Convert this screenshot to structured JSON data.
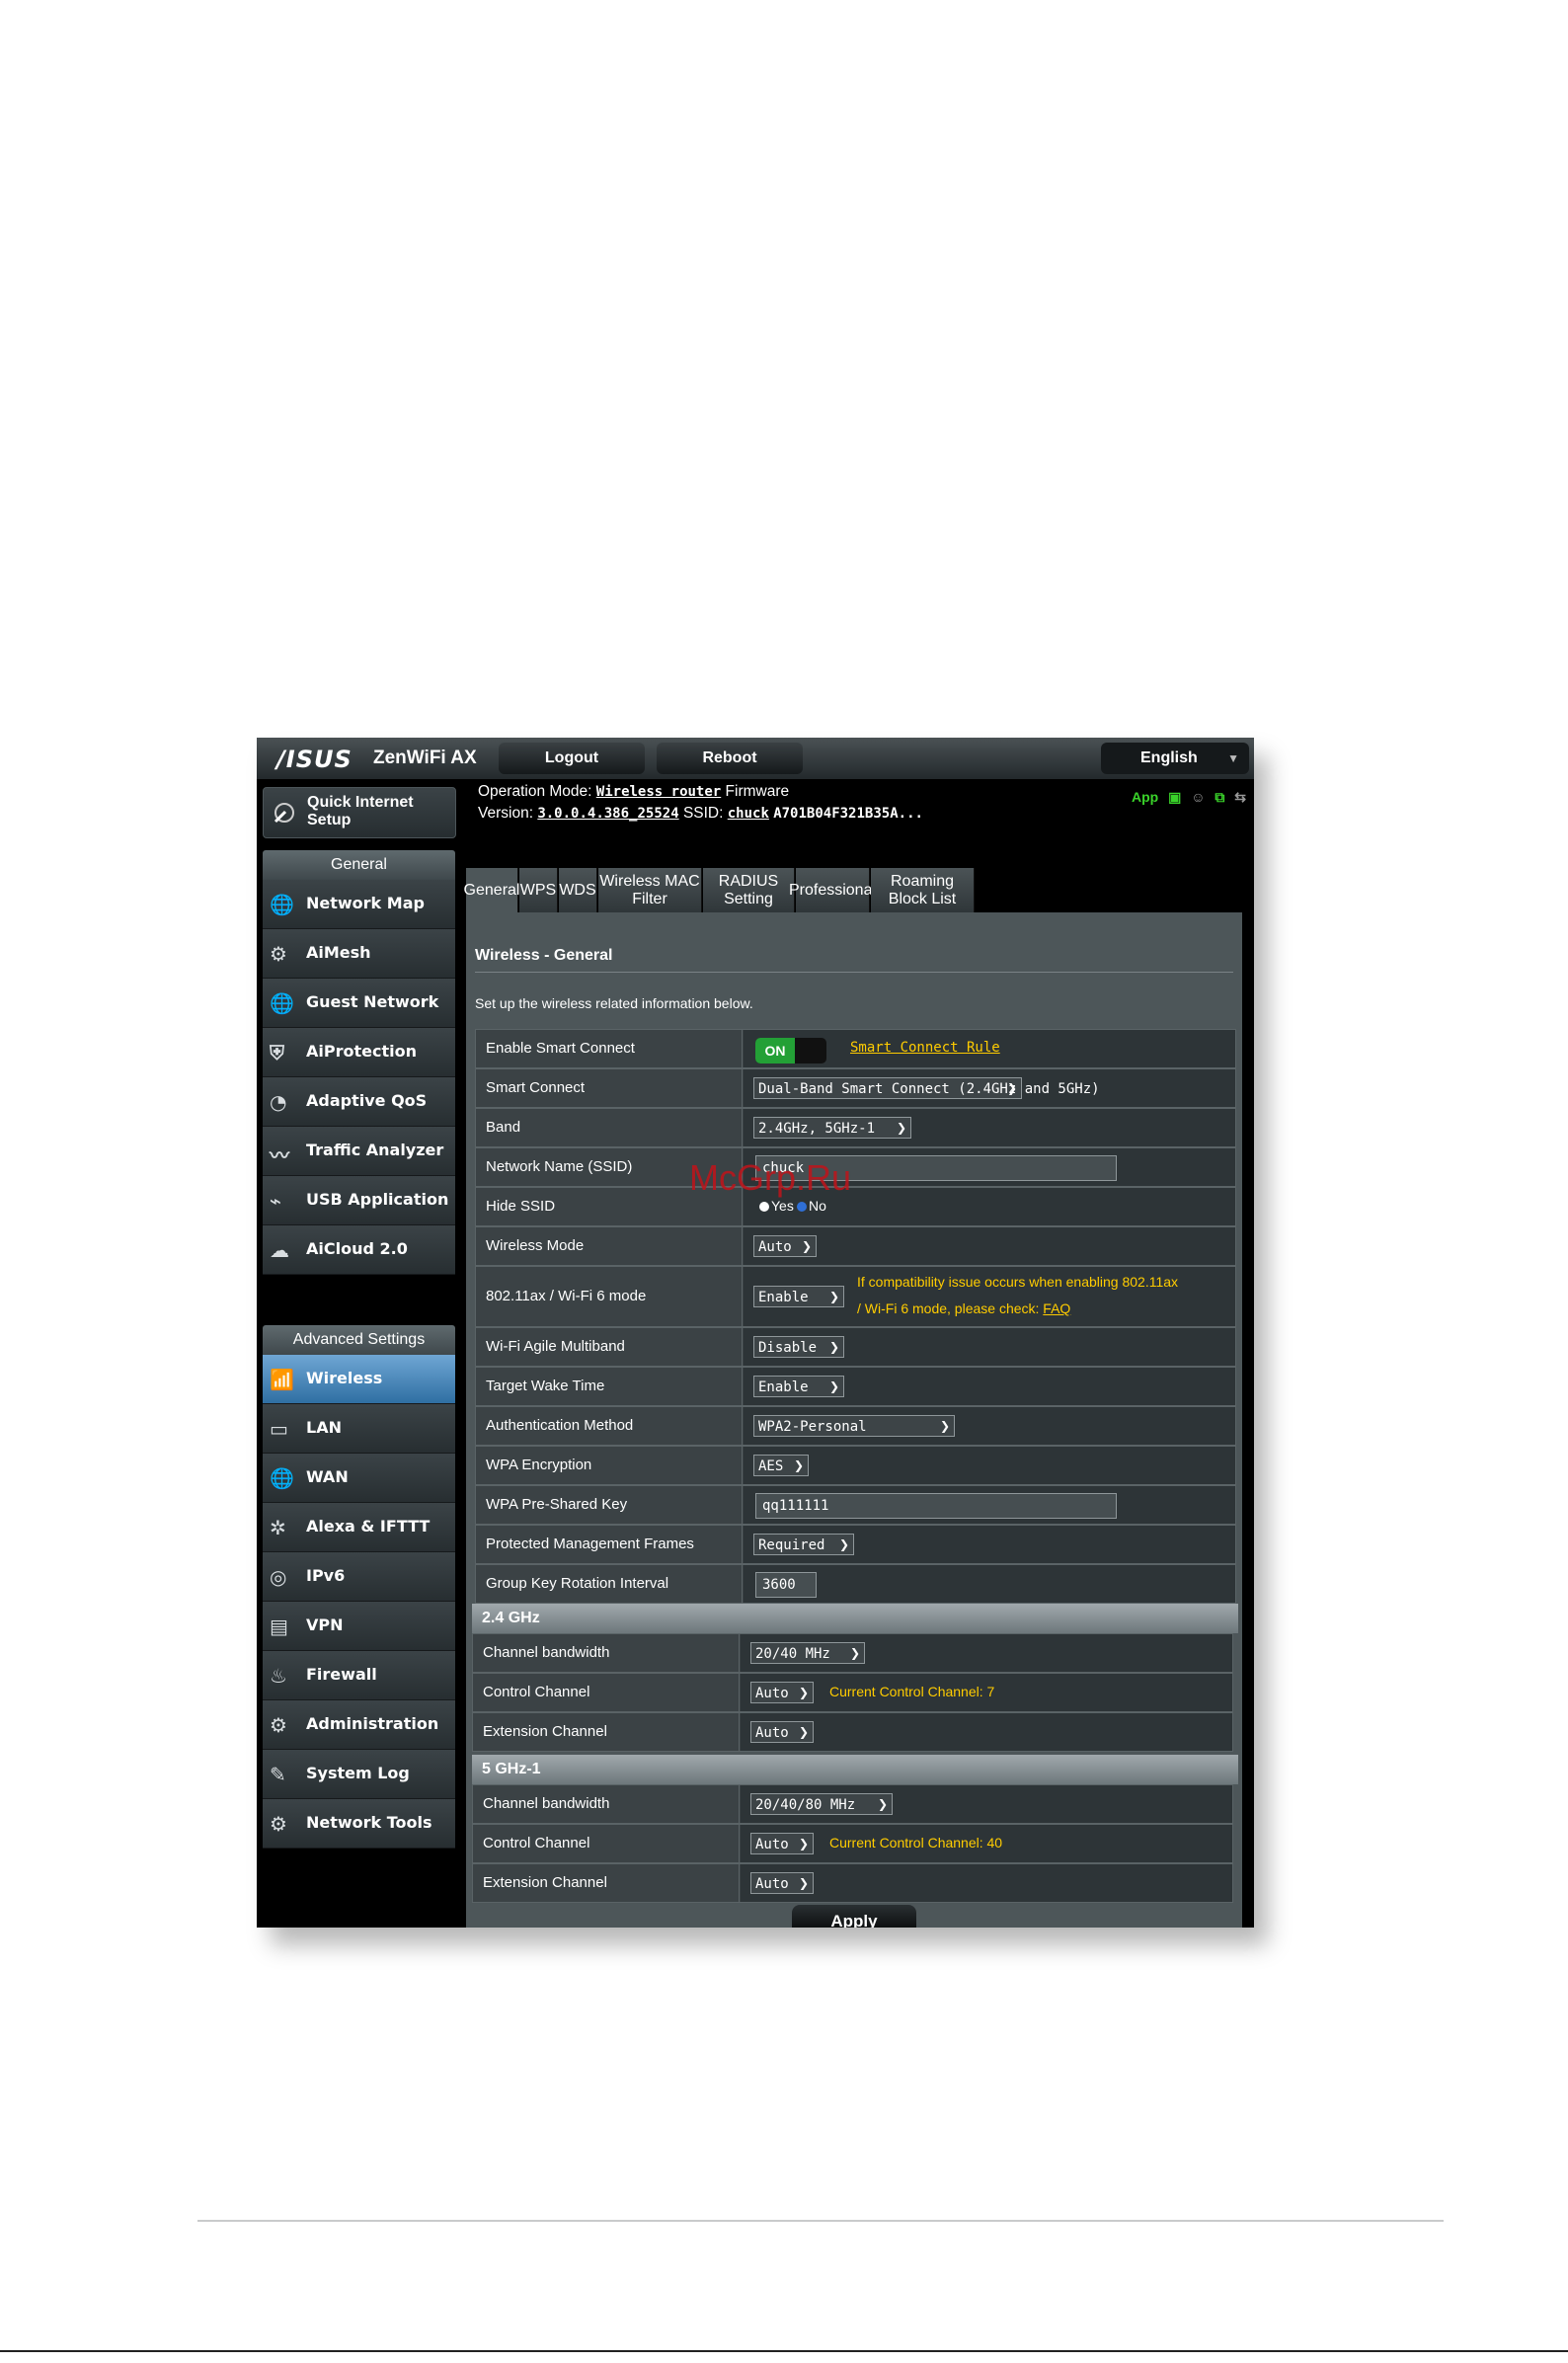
{
  "header": {
    "brand": "/ISUS",
    "model": "ZenWiFi AX",
    "logout_label": "Logout",
    "reboot_label": "Reboot",
    "language": "English"
  },
  "info": {
    "opmode_label": "Operation Mode:",
    "opmode_value": "Wireless router",
    "firmware_label": "Firmware",
    "version_label": "Version:",
    "version_value": "3.0.0.4.386_25524",
    "ssid_label": "SSID:",
    "ssid_value": "chuck",
    "ssid_extra": "A701B04F321B35A...",
    "app_label": "App"
  },
  "sidebar": {
    "qis_label": "Quick Internet Setup",
    "general_header": "General",
    "general_items": [
      {
        "label": "Network Map",
        "icon": "globe-icon"
      },
      {
        "label": "AiMesh",
        "icon": "mesh-icon"
      },
      {
        "label": "Guest Network",
        "icon": "guest-globe-icon"
      },
      {
        "label": "AiProtection",
        "icon": "shield-icon"
      },
      {
        "label": "Adaptive QoS",
        "icon": "gauge-icon"
      },
      {
        "label": "Traffic Analyzer",
        "icon": "pulse-icon"
      },
      {
        "label": "USB Application",
        "icon": "usb-icon"
      },
      {
        "label": "AiCloud 2.0",
        "icon": "cloud-icon"
      }
    ],
    "advanced_header": "Advanced Settings",
    "advanced_items": [
      {
        "label": "Wireless",
        "icon": "wifi-icon"
      },
      {
        "label": "LAN",
        "icon": "lan-icon"
      },
      {
        "label": "WAN",
        "icon": "wan-globe-icon"
      },
      {
        "label": "Alexa & IFTTT",
        "icon": "alexa-icon"
      },
      {
        "label": "IPv6",
        "icon": "ipv6-icon"
      },
      {
        "label": "VPN",
        "icon": "vpn-icon"
      },
      {
        "label": "Firewall",
        "icon": "fire-icon"
      },
      {
        "label": "Administration",
        "icon": "admin-icon"
      },
      {
        "label": "System Log",
        "icon": "log-icon"
      },
      {
        "label": "Network Tools",
        "icon": "tools-icon"
      }
    ]
  },
  "tabs": [
    "General",
    "WPS",
    "WDS",
    "Wireless MAC Filter",
    "RADIUS Setting",
    "Professional",
    "Roaming Block List"
  ],
  "page": {
    "title": "Wireless - General",
    "description": "Set up the wireless related information below."
  },
  "rows": {
    "smart_connect_enable": {
      "label": "Enable Smart Connect",
      "toggle": "ON",
      "link": "Smart Connect Rule"
    },
    "smart_connect": {
      "label": "Smart Connect",
      "value": "Dual-Band Smart Connect (2.4GHz and 5GHz)"
    },
    "band": {
      "label": "Band",
      "value": "2.4GHz, 5GHz-1"
    },
    "ssid": {
      "label": "Network Name (SSID)",
      "value": "chuck"
    },
    "hide_ssid": {
      "label": "Hide SSID",
      "yes": "Yes",
      "no": "No"
    },
    "wireless_mode": {
      "label": "Wireless Mode",
      "value": "Auto"
    },
    "wifi6": {
      "label": "802.11ax / Wi-Fi 6 mode",
      "value": "Enable",
      "note1": "If compatibility issue occurs when enabling 802.11ax",
      "note2": "/ Wi-Fi 6 mode, please check:",
      "faq": "FAQ"
    },
    "agile": {
      "label": "Wi-Fi Agile Multiband",
      "value": "Disable"
    },
    "twt": {
      "label": "Target Wake Time",
      "value": "Enable"
    },
    "auth": {
      "label": "Authentication Method",
      "value": "WPA2-Personal"
    },
    "wpa_enc": {
      "label": "WPA Encryption",
      "value": "AES"
    },
    "psk": {
      "label": "WPA Pre-Shared Key",
      "value": "qq111111"
    },
    "pmf": {
      "label": "Protected Management Frames",
      "value": "Required"
    },
    "gkri": {
      "label": "Group Key Rotation Interval",
      "value": "3600"
    }
  },
  "band24": {
    "header": "2.4 GHz",
    "bw": {
      "label": "Channel bandwidth",
      "value": "20/40 MHz"
    },
    "ctrl": {
      "label": "Control Channel",
      "value": "Auto",
      "note": "Current Control Channel: 7"
    },
    "ext": {
      "label": "Extension Channel",
      "value": "Auto"
    }
  },
  "band5": {
    "header": "5 GHz-1",
    "bw": {
      "label": "Channel bandwidth",
      "value": "20/40/80 MHz"
    },
    "ctrl": {
      "label": "Control Channel",
      "value": "Auto",
      "note": "Current Control Channel: 40"
    },
    "ext": {
      "label": "Extension Channel",
      "value": "Auto"
    }
  },
  "apply_label": "Apply",
  "watermark": "McGrp.Ru"
}
